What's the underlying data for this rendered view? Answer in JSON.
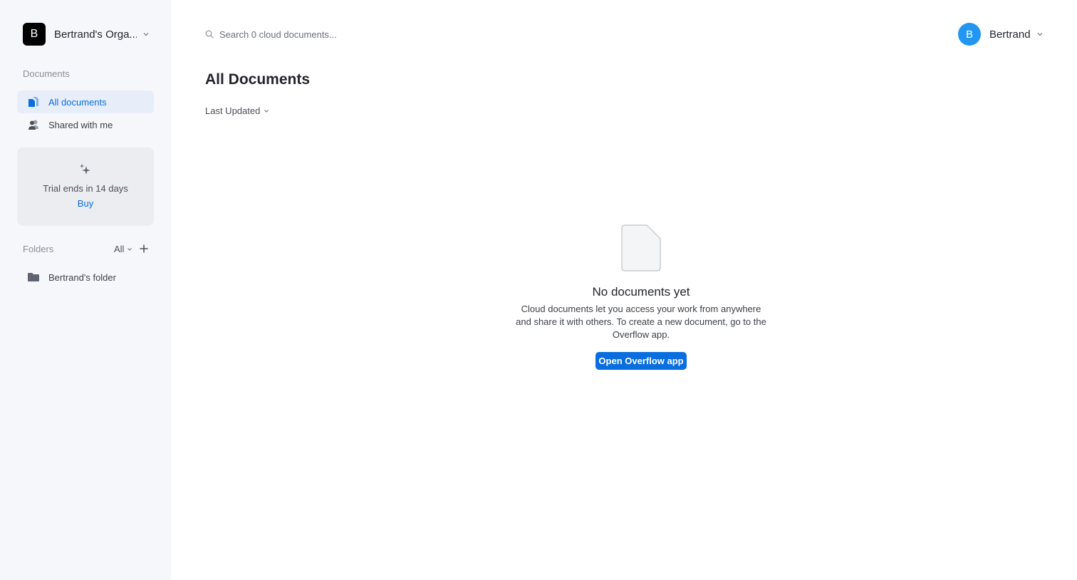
{
  "sidebar": {
    "org": {
      "initial": "B",
      "name": "Bertrand's Orga..."
    },
    "documents_label": "Documents",
    "nav": [
      {
        "label": "All documents",
        "icon": "documents-icon",
        "active": true
      },
      {
        "label": "Shared with me",
        "icon": "shared-users-icon",
        "active": false
      }
    ],
    "trial": {
      "text": "Trial ends in 14 days",
      "buy": "Buy",
      "icon": "sparkles-icon"
    },
    "folders": {
      "label": "Folders",
      "filter": "All",
      "items": [
        {
          "label": "Bertrand's folder",
          "icon": "folder-icon"
        }
      ]
    }
  },
  "header": {
    "search": {
      "placeholder": "Search 0 cloud documents...",
      "value": ""
    },
    "user": {
      "initial": "B",
      "name": "Bertrand"
    }
  },
  "main": {
    "title": "All Documents",
    "sort_label": "Last Updated",
    "empty": {
      "title": "No documents yet",
      "description": "Cloud documents let you access your work from anywhere and share it with others. To create a new document, go to the Overflow app.",
      "button": "Open Overflow app"
    }
  },
  "colors": {
    "accent": "#0a6ee0",
    "sidebar_bg": "#f6f7fa",
    "active_bg": "#e8eef9",
    "user_avatar": "#2196f3"
  }
}
